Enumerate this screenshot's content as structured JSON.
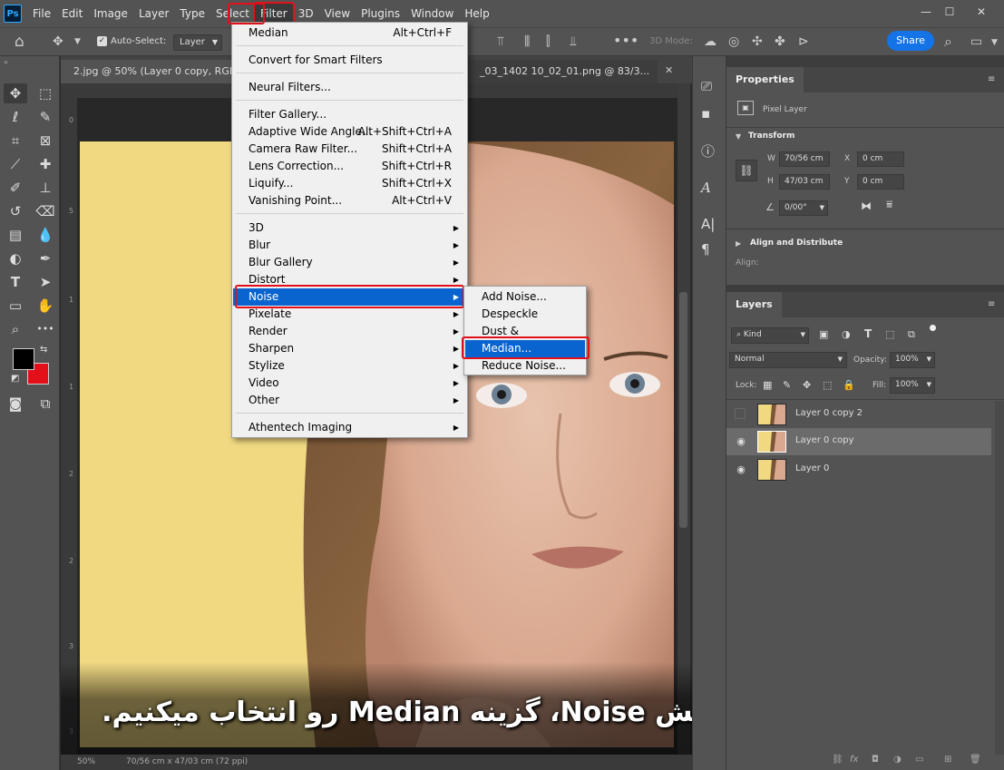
{
  "app": {
    "logo": "Ps",
    "name": "Photoshop"
  },
  "menubar": {
    "items": [
      "File",
      "Edit",
      "Image",
      "Layer",
      "Type",
      "Select",
      "Filter",
      "3D",
      "View",
      "Plugins",
      "Window",
      "Help"
    ],
    "active": "Filter"
  },
  "window_controls": [
    "minimize-icon",
    "maximize-icon",
    "close-icon"
  ],
  "options_bar": {
    "auto_select_label": "Auto-Select:",
    "auto_select_checked": true,
    "auto_select_target": "Layer",
    "mode_3d_label": "3D Mode:",
    "share_label": "Share"
  },
  "document_tabs": [
    {
      "label": "2.jpg @ 50% (Layer 0 copy, RGB/8",
      "active": true
    },
    {
      "label": "_03_1402 10_02_01.png @ 83/3...",
      "active": false
    }
  ],
  "ruler": {
    "left_marks": [
      "0",
      "5",
      "1",
      "1",
      "2",
      "2",
      "3",
      "3"
    ]
  },
  "status_bar": {
    "zoom": "50%",
    "doc_info": "70/56 cm x 47/03 cm (72 ppi)"
  },
  "filter_menu": {
    "groups": [
      [
        {
          "label": "Median",
          "shortcut": "Alt+Ctrl+F"
        }
      ],
      [
        {
          "label": "Convert for Smart Filters",
          "shortcut": ""
        }
      ],
      [
        {
          "label": "Neural Filters...",
          "shortcut": ""
        }
      ],
      [
        {
          "label": "Filter Gallery...",
          "shortcut": ""
        },
        {
          "label": "Adaptive Wide Angle...",
          "shortcut": "Alt+Shift+Ctrl+A"
        },
        {
          "label": "Camera Raw Filter...",
          "shortcut": "Shift+Ctrl+A"
        },
        {
          "label": "Lens Correction...",
          "shortcut": "Shift+Ctrl+R"
        },
        {
          "label": "Liquify...",
          "shortcut": "Shift+Ctrl+X"
        },
        {
          "label": "Vanishing Point...",
          "shortcut": "Alt+Ctrl+V"
        }
      ],
      [
        {
          "label": "3D",
          "submenu": true
        },
        {
          "label": "Blur",
          "submenu": true
        },
        {
          "label": "Blur Gallery",
          "submenu": true
        },
        {
          "label": "Distort",
          "submenu": true
        },
        {
          "label": "Noise",
          "submenu": true,
          "highlighted": true
        },
        {
          "label": "Pixelate",
          "submenu": true
        },
        {
          "label": "Render",
          "submenu": true
        },
        {
          "label": "Sharpen",
          "submenu": true
        },
        {
          "label": "Stylize",
          "submenu": true
        },
        {
          "label": "Video",
          "submenu": true
        },
        {
          "label": "Other",
          "submenu": true
        }
      ],
      [
        {
          "label": "Athentech Imaging",
          "submenu": true
        }
      ]
    ]
  },
  "noise_submenu": {
    "items": [
      {
        "label": "Add Noise..."
      },
      {
        "label": "Despeckle"
      },
      {
        "label": "Dust & Scratches..."
      },
      {
        "label": "Median...",
        "highlighted": true
      },
      {
        "label": "Reduce Noise..."
      }
    ]
  },
  "properties_panel": {
    "tab": "Properties",
    "layer_type": "Pixel Layer",
    "transform_heading": "Transform",
    "w_label": "W",
    "w_value": "70/56 cm",
    "h_label": "H",
    "h_value": "47/03 cm",
    "x_label": "X",
    "x_value": "0 cm",
    "y_label": "Y",
    "y_value": "0 cm",
    "angle_value": "0/00°",
    "align_heading": "Align and Distribute",
    "align_label": "Align:"
  },
  "layers_panel": {
    "tab": "Layers",
    "filter_kind": "Kind",
    "blend_mode": "Normal",
    "opacity_label": "Opacity:",
    "opacity_value": "100%",
    "lock_label": "Lock:",
    "fill_label": "Fill:",
    "fill_value": "100%",
    "layers": [
      {
        "name": "Layer 0 copy 2",
        "visible": false,
        "selected": false
      },
      {
        "name": "Layer 0 copy",
        "visible": true,
        "selected": true
      },
      {
        "name": "Layer 0",
        "visible": true,
        "selected": false
      }
    ]
  },
  "caption": "از منو Filter، بخش Noise، گزینه Median رو انتخاب میکنیم.",
  "colors": {
    "ui_panel": "#535353",
    "ui_dark": "#2b2b2b",
    "menu_bg": "#f0f0f0",
    "menu_highlight": "#0a64d0",
    "annotation_red": "#e3101a",
    "share_blue": "#1473e6",
    "foreground_color": "#000000",
    "background_color": "#e3101a",
    "photo_background": "#f1d982"
  }
}
